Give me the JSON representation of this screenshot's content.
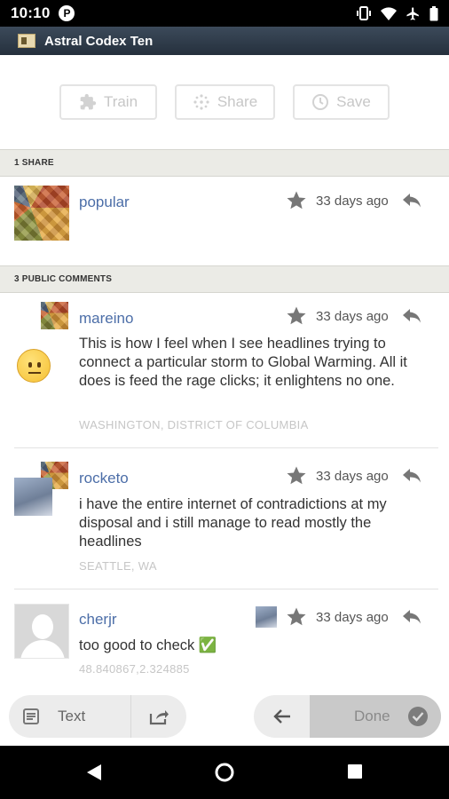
{
  "status_bar": {
    "time": "10:10",
    "app_badge": "P"
  },
  "header": {
    "title": "Astral Codex Ten"
  },
  "actions": {
    "train": "Train",
    "share": "Share",
    "save": "Save"
  },
  "shares": {
    "header": "1 SHARE",
    "items": [
      {
        "username": "popular",
        "time": "33 days ago"
      }
    ]
  },
  "comments": {
    "header": "3 PUBLIC COMMENTS",
    "items": [
      {
        "username": "mareino",
        "time": "33 days ago",
        "text": "This is how I feel when I see headlines trying to connect a particular storm to Global Warming. All it does is feed the rage clicks; it enlightens no one.",
        "location": "WASHINGTON, DISTRICT OF COLUMBIA"
      },
      {
        "username": "rocketo",
        "time": "33 days ago",
        "text": "i have the entire internet of contradictions at my disposal and i still manage to read mostly the headlines",
        "location": "SEATTLE, WA"
      },
      {
        "username": "cherjr",
        "time": "33 days ago",
        "text": "too good to check ✅",
        "location": "48.840867,2.324885"
      }
    ]
  },
  "bottom_bar": {
    "text_label": "Text",
    "done_label": "Done"
  },
  "colors": {
    "link": "#4c6ea8",
    "header_bg": "#2f3b49",
    "section_bg": "#ebebe6"
  }
}
